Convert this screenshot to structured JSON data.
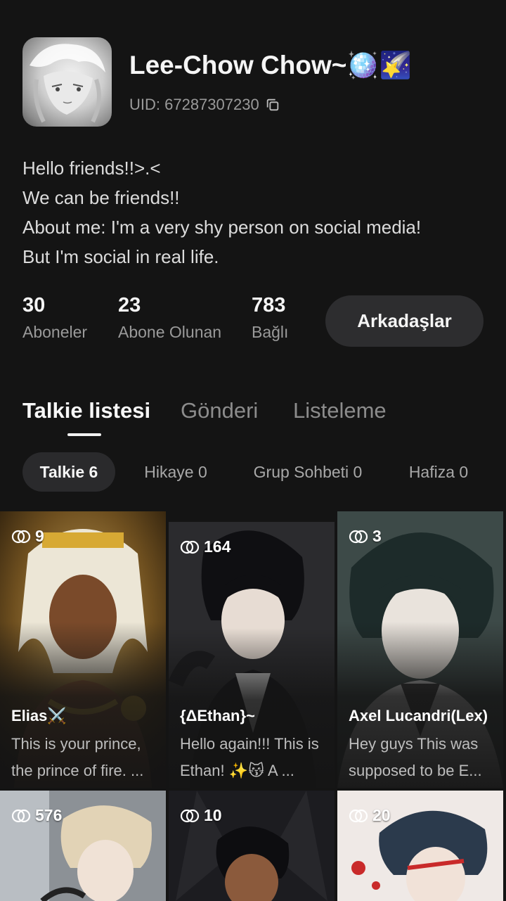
{
  "profile": {
    "name": "Lee-Chow Chow~🪩🌠",
    "uid": "UID: 67287307230",
    "bio": [
      "Hello friends!!>.<",
      "We can be friends!!",
      "About me: I'm a very shy person on social media!",
      "But I'm social in real life."
    ]
  },
  "stats": [
    {
      "value": "30",
      "label": "Aboneler"
    },
    {
      "value": "23",
      "label": "Abone Olunan"
    },
    {
      "value": "783",
      "label": "Bağlı"
    }
  ],
  "friends_button": "Arkadaşlar",
  "tabs": [
    "Talkie listesi",
    "Gönderi",
    "Listeleme"
  ],
  "active_tab": "Talkie listesi",
  "chips": [
    "Talkie 6",
    "Hikaye 0",
    "Grup Sohbeti 0",
    "Hafiza 0"
  ],
  "active_chip": "Talkie 6",
  "cards": [
    {
      "count": "9",
      "title": "Elias⚔️",
      "desc": "This is your prince, the prince of fire. ..."
    },
    {
      "count": "164",
      "title": "{ΔEthan}~",
      "desc": "Hello again!!! This is Ethan! ✨😽 A ..."
    },
    {
      "count": "3",
      "title": "Axel Lucandri(Lex)",
      "desc": "Hey guys This was supposed to be E..."
    },
    {
      "count": "576",
      "title": "",
      "desc": ""
    },
    {
      "count": "10",
      "title": "",
      "desc": ""
    },
    {
      "count": "20",
      "title": "",
      "desc": ""
    }
  ],
  "icons": {
    "copy": "copy-icon",
    "chat_count": "chat-bubbles-icon"
  },
  "colors": {
    "background": "#141414",
    "button": "#2d2d2f",
    "muted_text": "#9a9a9a"
  }
}
